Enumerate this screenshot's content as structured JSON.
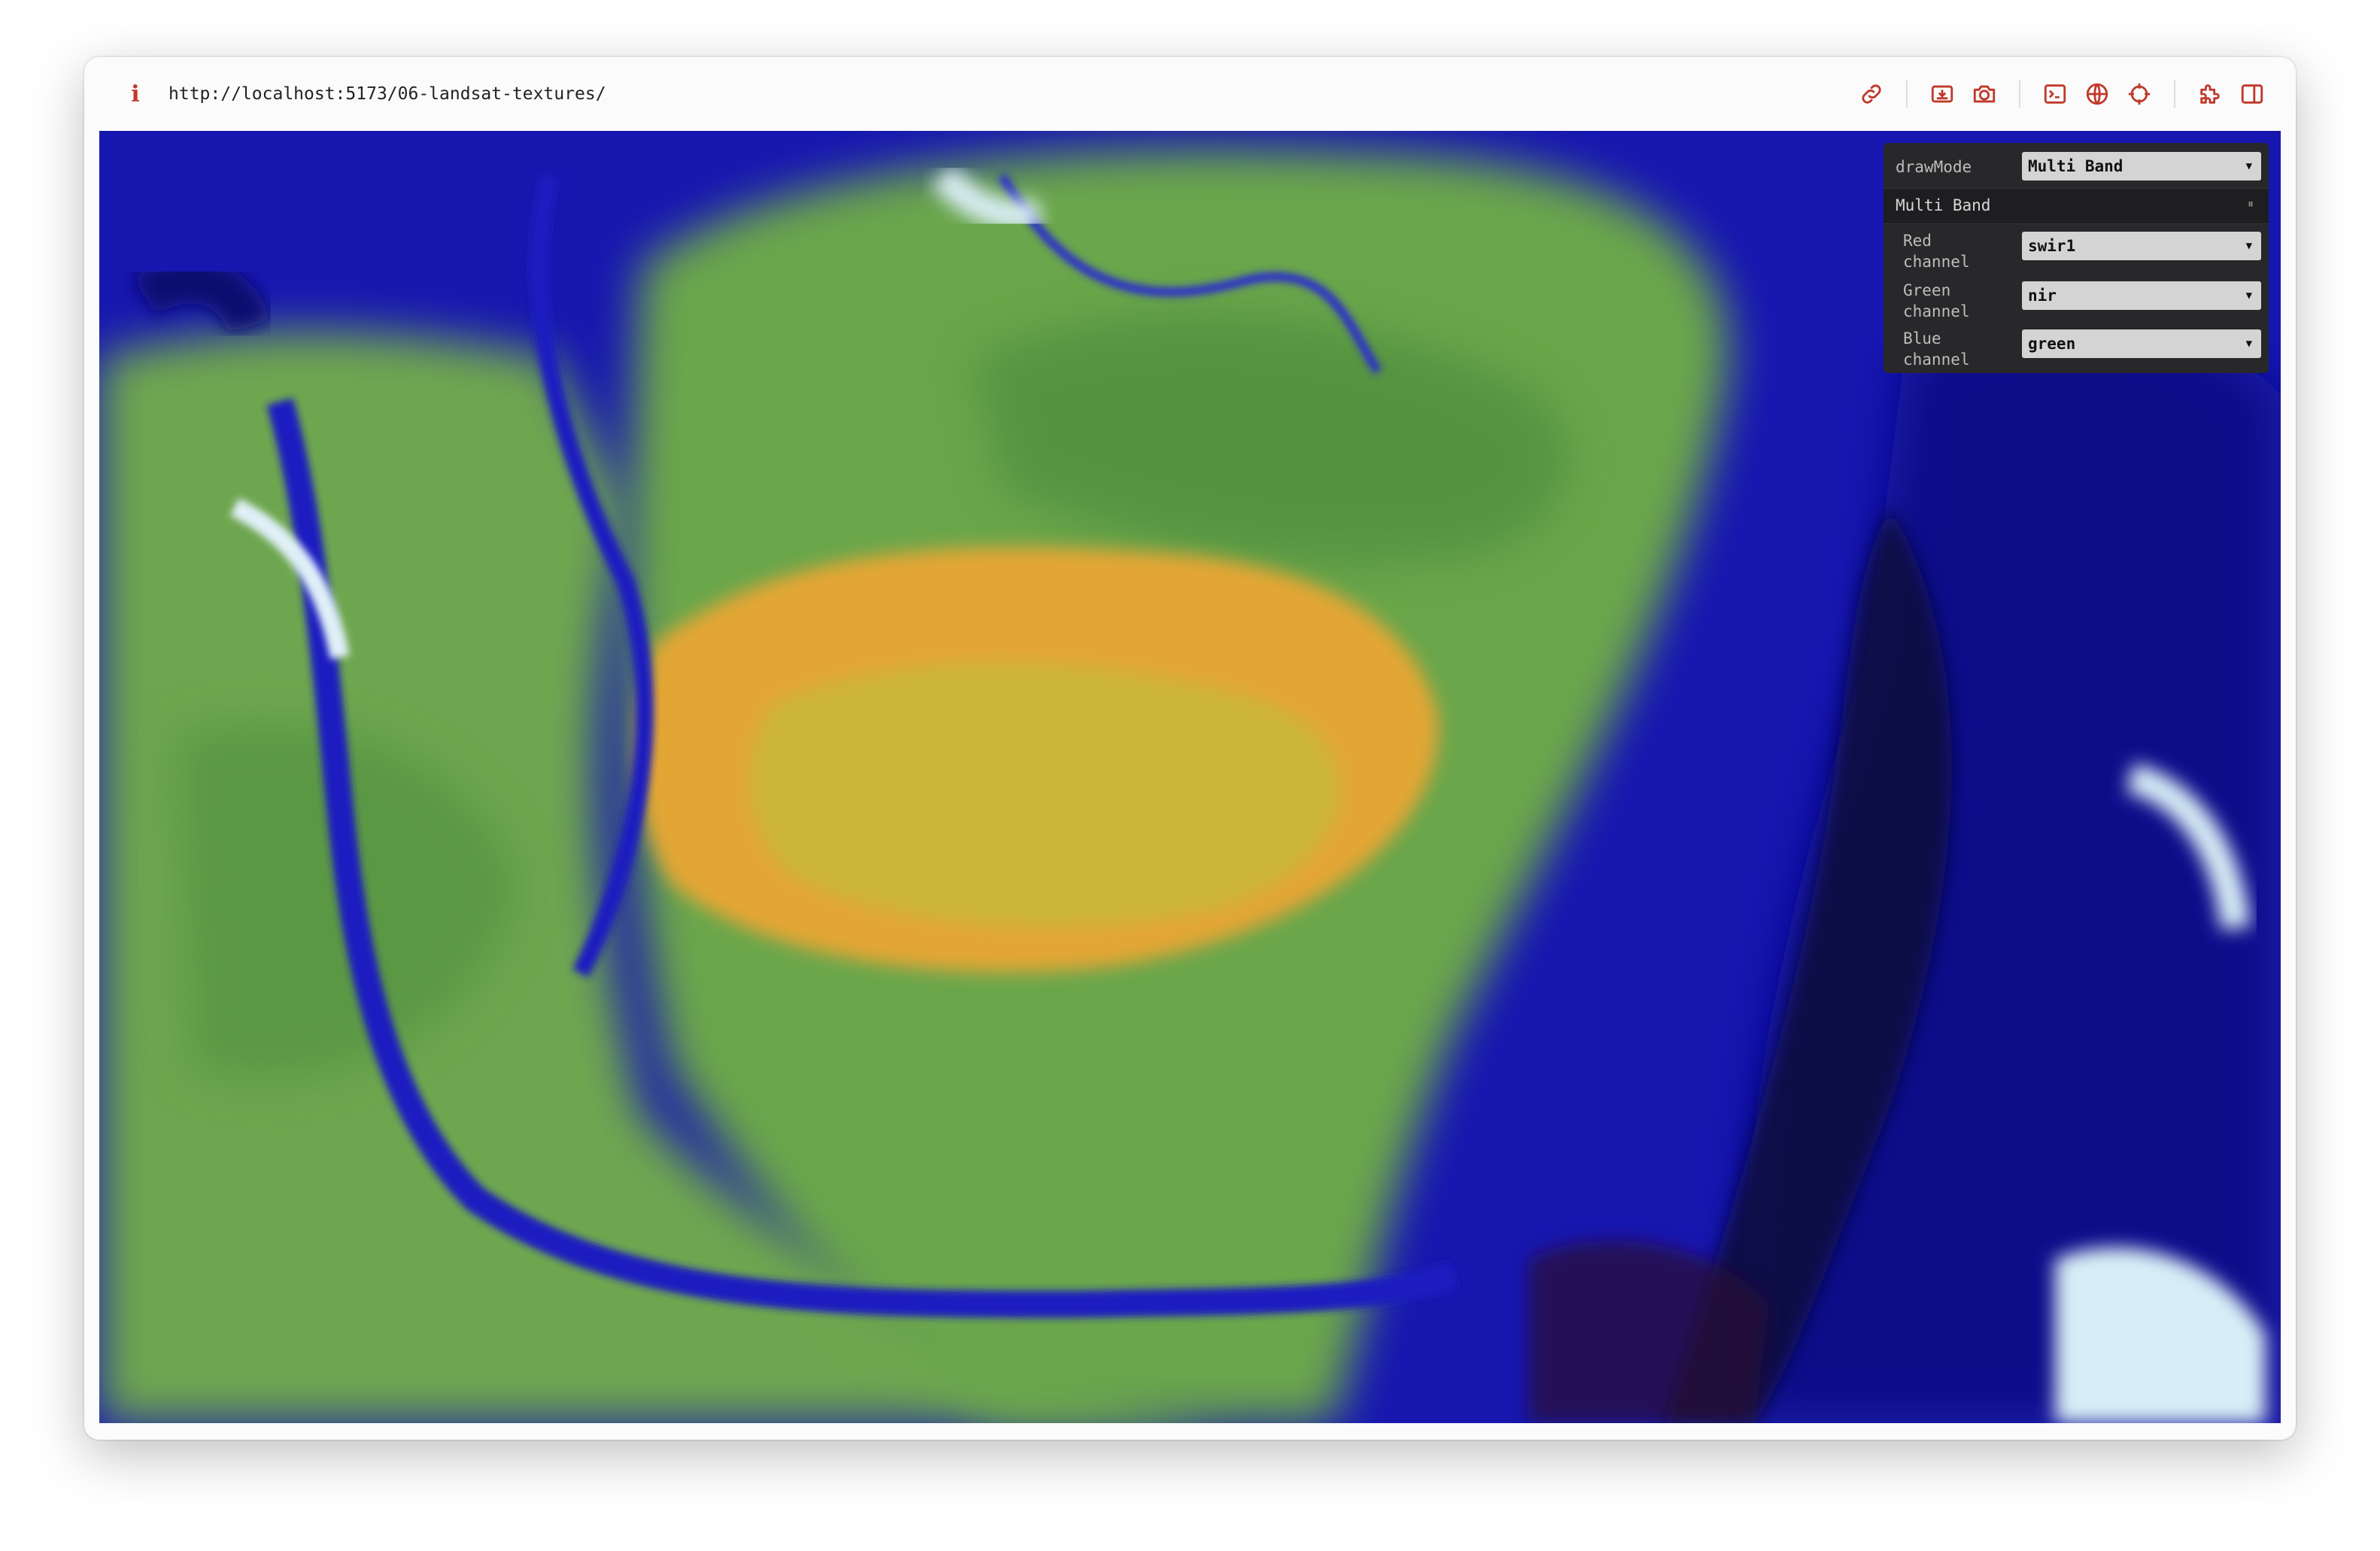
{
  "browser": {
    "info_icon": "info-icon",
    "url": "http://localhost:5173/06-landsat-textures/",
    "toolbar_icons": [
      "link-icon",
      "download-icon",
      "camera-icon",
      "terminal-icon",
      "globe-icon",
      "crosshair-icon",
      "extension-icon",
      "sidebar-icon"
    ],
    "accent_color": "#c0392b"
  },
  "panel": {
    "draw_mode": {
      "label": "drawMode",
      "value": "Multi Band"
    },
    "folder": {
      "title": "Multi Band",
      "toggle": "⏸",
      "channels": [
        {
          "label": "Red channel",
          "value": "swir1"
        },
        {
          "label": "Green channel",
          "value": "nir"
        },
        {
          "label": "Blue channel",
          "value": "green"
        }
      ]
    }
  },
  "viewport": {
    "description_colors": {
      "water": "#1414b4",
      "vegetation": "#5fa04a",
      "highlight": "#e0a030"
    }
  }
}
